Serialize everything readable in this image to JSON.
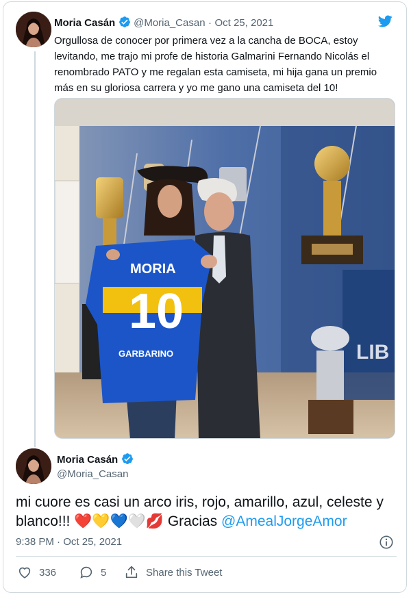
{
  "tweet1": {
    "name": "Moria Casán",
    "handle": "@Moria_Casan",
    "separator": "·",
    "date": "Oct 25, 2021",
    "text": "Orgullosa de conocer por primera vez a la cancha de BOCA, estoy levitando, me trajo mi profe de historia Galmarini Fernando Nicolás el renombrado PATO y me regalan esta camiseta, mi hija gana un premio más en su gloriosa carrera y yo me gano una camiseta del 10!"
  },
  "photo": {
    "shirt_name": "MORIA",
    "shirt_number": "10",
    "sponsor": "GARBARINO",
    "trophy_text": "LIB"
  },
  "tweet2": {
    "name": "Moria Casán",
    "handle": "@Moria_Casan",
    "text_before": "mi cuore es casi un arco iris, rojo, amarillo, azul, celeste y blanco!!! ",
    "emojis": "❤️💛💙🤍💋",
    "text_gracias": " Gracias ",
    "mention": "@AmealJorgeAmor",
    "time": "9:38 PM",
    "date_sep": "·",
    "date": "Oct 25, 2021"
  },
  "actions": {
    "likes": "336",
    "replies": "5",
    "share_label": "Share this Tweet"
  },
  "colors": {
    "accent": "#1d9bf0",
    "verified": "#1d9bf0",
    "text": "#0f1419",
    "secondary": "#536471",
    "border": "#cfd9de"
  },
  "icons": [
    "twitter-bird-icon",
    "verified-badge-icon",
    "info-icon",
    "heart-icon",
    "reply-icon",
    "share-icon"
  ]
}
